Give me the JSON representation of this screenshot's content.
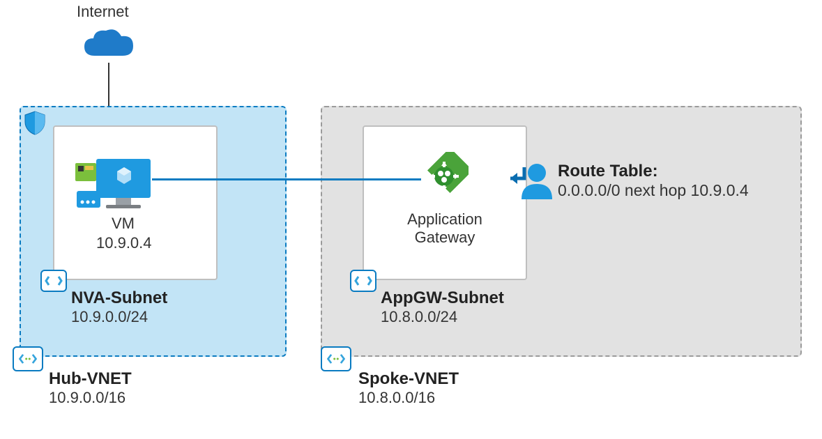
{
  "internet": {
    "label": "Internet"
  },
  "hub_vnet": {
    "name": "Hub-VNET",
    "cidr": "10.9.0.0/16"
  },
  "nva_subnet": {
    "name": "NVA-Subnet",
    "cidr": "10.9.0.0/24"
  },
  "vm": {
    "label": "VM",
    "ip": "10.9.0.4"
  },
  "spoke_vnet": {
    "name": "Spoke-VNET",
    "cidr": "10.8.0.0/16"
  },
  "appgw_subnet": {
    "name": "AppGW-Subnet",
    "cidr": "10.8.0.0/24"
  },
  "appgw": {
    "label1": "Application",
    "label2": "Gateway"
  },
  "route_table": {
    "title": "Route Table:",
    "entry": "0.0.0.0/0 next hop 10.9.0.4"
  }
}
